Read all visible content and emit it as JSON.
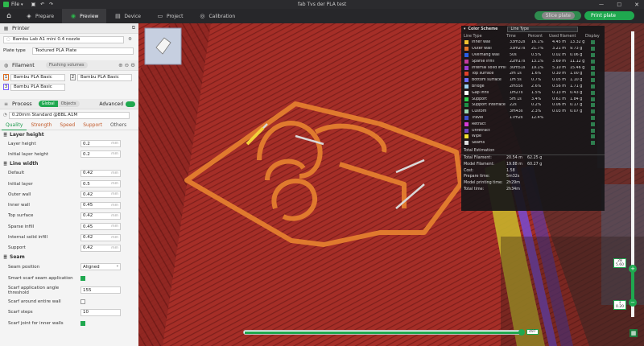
{
  "app": {
    "file_menu": "File",
    "window_title": "fab Tvs der PLA test"
  },
  "nav": {
    "tabs": [
      {
        "label": "Prepare",
        "active": false
      },
      {
        "label": "Preview",
        "active": true
      },
      {
        "label": "Device",
        "active": false
      },
      {
        "label": "Project",
        "active": false
      },
      {
        "label": "Calibration",
        "active": false
      }
    ],
    "slice_plate": "Slice plate",
    "print_plate": "Print plate"
  },
  "printer": {
    "section": "Printer",
    "name": "Bambu Lab A1 mini 0.4 nozzle",
    "plate_label": "Plate type",
    "plate_value": "Textured PLA Plate"
  },
  "filament": {
    "section": "Filament",
    "badge": "Flushing volumes",
    "slots": [
      {
        "num": "1",
        "name": "Bambu PLA Basic",
        "color": "#e06a1c"
      },
      {
        "num": "2",
        "name": "Bambu PLA Basic",
        "color": "#d0d0d0"
      },
      {
        "num": "3",
        "name": "Bambu PLA Basic",
        "color": "#7a5cff"
      }
    ]
  },
  "process": {
    "section": "Process",
    "toggle_global": "Global",
    "toggle_objects": "Objects",
    "advanced": "Advanced",
    "preset": "0.20mm Standard @BBL A1M",
    "tabs": [
      "Quality",
      "Strength",
      "Speed",
      "Support",
      "Others"
    ],
    "layer_height_group": "Layer height",
    "layer_rows": [
      {
        "label": "Layer height",
        "value": "0.2",
        "unit": "mm"
      },
      {
        "label": "Initial layer height",
        "value": "0.2",
        "unit": "mm"
      }
    ],
    "line_width_group": "Line width",
    "line_rows": [
      {
        "label": "Default",
        "value": "0.42",
        "unit": "mm"
      },
      {
        "label": "Initial layer",
        "value": "0.5",
        "unit": "mm"
      },
      {
        "label": "Outer wall",
        "value": "0.42",
        "unit": "mm"
      },
      {
        "label": "Inner wall",
        "value": "0.45",
        "unit": "mm"
      },
      {
        "label": "Top surface",
        "value": "0.42",
        "unit": "mm"
      },
      {
        "label": "Sparse infill",
        "value": "0.45",
        "unit": "mm"
      },
      {
        "label": "Internal solid infill",
        "value": "0.42",
        "unit": "mm"
      },
      {
        "label": "Support",
        "value": "0.42",
        "unit": "mm"
      }
    ],
    "seam_group": "Seam",
    "seam_position_label": "Seam position",
    "seam_position_value": "Aligned",
    "scarf_label": "Smart scarf seam application",
    "scarf_angle_label": "Scarf application angle threshold",
    "scarf_angle_value": "155",
    "scarf_entire_label": "Scarf around entire wall",
    "scarf_steps_label": "Scarf steps",
    "scarf_steps_value": "10",
    "scarf_inner_label": "Scarf joint for inner walls"
  },
  "legend": {
    "title": "Color Scheme",
    "mode": "Line Type",
    "headers": [
      "Line Type",
      "Time",
      "Percent",
      "Used filament",
      "Display"
    ],
    "rows": [
      {
        "name": "Inner wall",
        "time": "33m32s",
        "pct": "16.1%",
        "used": "4.45 m",
        "g": "13.32 g",
        "color": "#f2c230"
      },
      {
        "name": "Outer wall",
        "time": "33m27s",
        "pct": "21.7%",
        "used": "3.21 m",
        "g": "9.73 g",
        "color": "#e6762a"
      },
      {
        "name": "Overhang wall",
        "time": "50s",
        "pct": "0.5%",
        "used": "0.02 m",
        "g": "0.06 g",
        "color": "#2a5fe6"
      },
      {
        "name": "Sparse infill",
        "time": "22m17s",
        "pct": "13.1%",
        "used": "3.69 m",
        "g": "11.12 g",
        "color": "#c43b9e"
      },
      {
        "name": "Internal solid infill",
        "time": "30m51s",
        "pct": "19.1%",
        "used": "5.10 m",
        "g": "15.46 g",
        "color": "#9c3bd6"
      },
      {
        "name": "Top surface",
        "time": "2m 1s",
        "pct": "1.6%",
        "used": "0.30 m",
        "g": "1.00 g",
        "color": "#e0412b"
      },
      {
        "name": "Bottom surface",
        "time": "1m 5s",
        "pct": "0.7%",
        "used": "0.05 m",
        "g": "1.10 g",
        "color": "#6d6dff"
      },
      {
        "name": "Bridge",
        "time": "2m55s",
        "pct": "2.6%",
        "used": "0.56 m",
        "g": "1.71 g",
        "color": "#9ad0f0"
      },
      {
        "name": "Gap infill",
        "time": "1m27s",
        "pct": "1.5%",
        "used": "0.13 m",
        "g": "0.43 g",
        "color": "#ffffff"
      },
      {
        "name": "Support",
        "time": "5m 1s",
        "pct": "3.4%",
        "used": "0.61 m",
        "g": "1.84 g",
        "color": "#2fd24c"
      },
      {
        "name": "Support interface",
        "time": "22s",
        "pct": "0.2%",
        "used": "0.06 m",
        "g": "0.17 g",
        "color": "#1e8f45"
      },
      {
        "name": "Custom",
        "time": "3m43s",
        "pct": "2.3%",
        "used": "0.03 m",
        "g": "0.07 g",
        "color": "#9ad8b0"
      },
      {
        "name": "Travel",
        "time": "17m2s",
        "pct": "12.4%",
        "used": "",
        "g": "",
        "color": "#3b4fcf"
      },
      {
        "name": "Retract",
        "time": "",
        "pct": "",
        "used": "",
        "g": "",
        "color": "#d63bd6"
      },
      {
        "name": "Unretract",
        "time": "",
        "pct": "",
        "used": "",
        "g": "",
        "color": "#6f42c1"
      },
      {
        "name": "Wipe",
        "time": "",
        "pct": "",
        "used": "",
        "g": "",
        "color": "#f2e230"
      },
      {
        "name": "Seams",
        "time": "",
        "pct": "",
        "used": "",
        "g": "",
        "color": "#dddddd"
      }
    ],
    "totals_title": "Total Estimation",
    "totals": [
      {
        "k": "Total Filament:",
        "v1": "20.54 m",
        "v2": "62.25 g"
      },
      {
        "k": "Model Filament:",
        "v1": "19.88 m",
        "v2": "60.27 g"
      },
      {
        "k": "Cost:",
        "v1": "1.58",
        "v2": ""
      },
      {
        "k": "Prepare time:",
        "v1": "5m32s",
        "v2": ""
      },
      {
        "k": "Model printing time:",
        "v1": "2h29m",
        "v2": ""
      },
      {
        "k": "Total time:",
        "v1": "2h34m",
        "v2": ""
      }
    ]
  },
  "slider": {
    "top": "5.60",
    "bottom": "0.20",
    "layer_top": "28",
    "layer_bottom": "1",
    "h_value": "497"
  }
}
